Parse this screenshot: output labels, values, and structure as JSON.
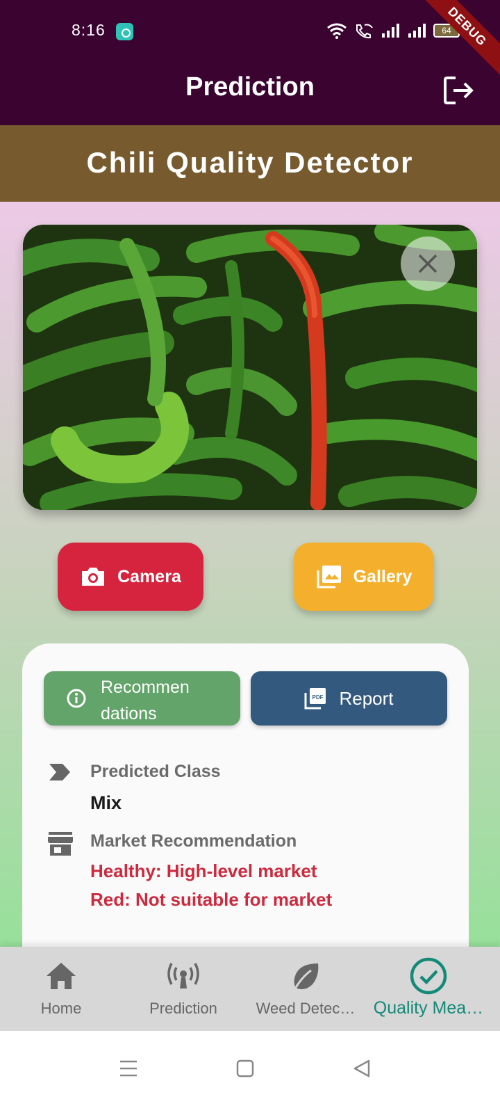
{
  "status_bar": {
    "time": "8:16",
    "battery": "64",
    "debug_label": "DEBUG"
  },
  "app_bar": {
    "title": "Prediction",
    "logout_icon": "logout-icon"
  },
  "header": {
    "title": "Chili Quality Detector"
  },
  "image_card": {
    "close_icon": "close-icon"
  },
  "actions": {
    "camera_label": "Camera",
    "gallery_label": "Gallery"
  },
  "result": {
    "recommendations_line1": "Recommen",
    "recommendations_line2": "dations",
    "report_label": "Report",
    "predicted_class_label": "Predicted Class",
    "predicted_class_value": "Mix",
    "market_label": "Market Recommendation",
    "market_lines": [
      "Healthy: High-level market",
      "Red: Not suitable for market"
    ]
  },
  "bottom_nav": {
    "items": [
      {
        "label": "Home",
        "icon": "home-icon",
        "active": false
      },
      {
        "label": "Prediction",
        "icon": "broadcast-icon",
        "active": false
      },
      {
        "label": "Weed Detec…",
        "icon": "leaf-icon",
        "active": false
      },
      {
        "label": "Quality Mea…",
        "icon": "check-circle-icon",
        "active": true
      }
    ]
  },
  "colors": {
    "app_bar": "#3a0330",
    "header_band": "#775b2f",
    "camera": "#d6243e",
    "gallery": "#f4b02c",
    "recommendations": "#62a46a",
    "report": "#335a7e",
    "accent": "#148a78",
    "market_text": "#cc2a3f"
  }
}
